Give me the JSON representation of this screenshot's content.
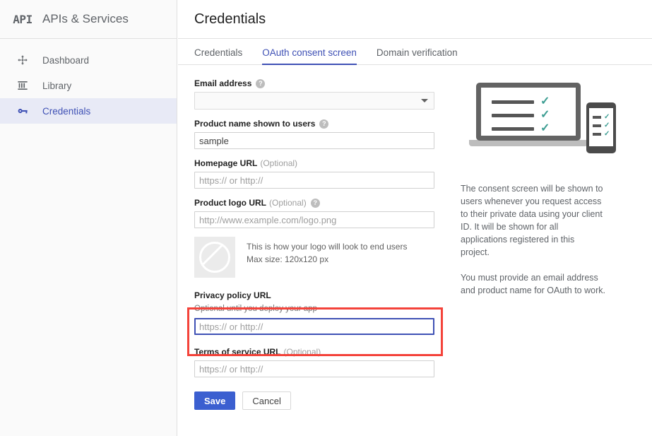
{
  "sidebar": {
    "logo_text": "API",
    "app_title": "APIs & Services",
    "items": [
      {
        "label": "Dashboard",
        "icon": "dashboard-move-icon"
      },
      {
        "label": "Library",
        "icon": "library-icon"
      },
      {
        "label": "Credentials",
        "icon": "key-icon"
      }
    ]
  },
  "header": {
    "page_title": "Credentials"
  },
  "tabs": [
    {
      "label": "Credentials",
      "active": false
    },
    {
      "label": "OAuth consent screen",
      "active": true
    },
    {
      "label": "Domain verification",
      "active": false
    }
  ],
  "form": {
    "email": {
      "label": "Email address",
      "help": "?",
      "value": ""
    },
    "product_name": {
      "label": "Product name shown to users",
      "help": "?",
      "value": "sample"
    },
    "homepage_url": {
      "label": "Homepage URL",
      "optional": "(Optional)",
      "placeholder": "https:// or http://",
      "value": ""
    },
    "product_logo_url": {
      "label": "Product logo URL",
      "optional": "(Optional)",
      "help": "?",
      "placeholder": "http://www.example.com/logo.png",
      "value": ""
    },
    "logo_preview": {
      "line1": "This is how your logo will look to end users",
      "line2": "Max size: 120x120 px",
      "icon": "no-entry-icon"
    },
    "privacy_policy_url": {
      "label": "Privacy policy URL",
      "sub_label": "Optional until you deploy your app",
      "placeholder": "https:// or http://",
      "value": "",
      "focused": true
    },
    "terms_of_service_url": {
      "label": "Terms of service URL",
      "optional": "(Optional)",
      "placeholder": "https:// or http://",
      "value": ""
    },
    "save_label": "Save",
    "cancel_label": "Cancel"
  },
  "rail": {
    "paragraph1": "The consent screen will be shown to users whenever you request access to their private data using your client ID. It will be shown for all applications registered in this project.",
    "paragraph2": "You must provide an email address and product name for OAuth to work."
  },
  "colors": {
    "accent_blue": "#3f51b5",
    "primary_button": "#3b5fd0",
    "highlight_red": "#f4433a",
    "check_teal": "#3c9d92",
    "selected_nav_bg": "#e8eaf6"
  }
}
